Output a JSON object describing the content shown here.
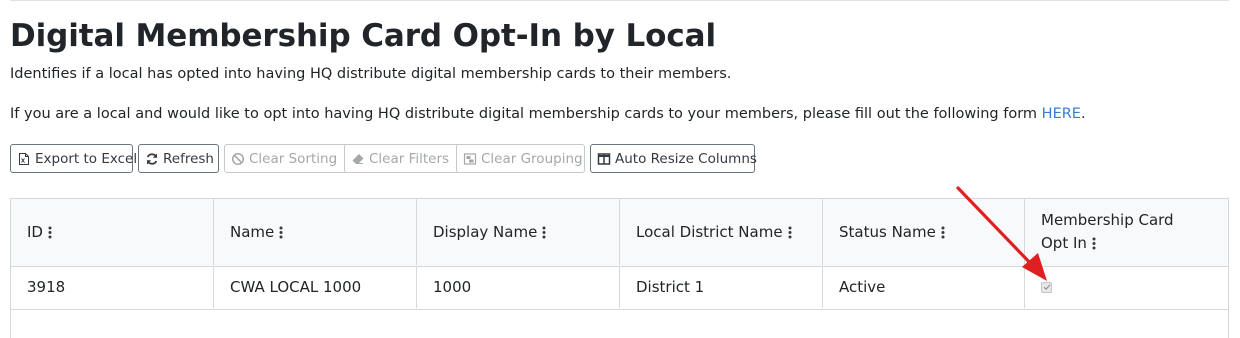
{
  "page": {
    "title": "Digital Membership Card Opt-In by Local",
    "description": "Identifies if a local has opted into having HQ distribute digital membership cards to their members.",
    "form_prompt": "If you are a local and would like to opt into having HQ distribute digital membership cards to your members, please fill out the following form ",
    "form_link": "HERE",
    "form_suffix": "."
  },
  "toolbar": {
    "export": "Export to Excel",
    "refresh": "Refresh",
    "clear_sorting": "Clear Sorting",
    "clear_filters": "Clear Filters",
    "clear_grouping": "Clear Grouping",
    "auto_resize": "Auto Resize Columns"
  },
  "table": {
    "columns": [
      "ID",
      "Name",
      "Display Name",
      "Local District Name",
      "Status Name",
      "Membership Card Opt In"
    ],
    "rows": [
      {
        "id": "3918",
        "name": "CWA LOCAL 1000",
        "display_name": "1000",
        "district": "District 1",
        "status": "Active",
        "opt_in": true
      }
    ]
  },
  "colors": {
    "link": "#3a7bd5",
    "annotation_arrow": "#e02020"
  }
}
